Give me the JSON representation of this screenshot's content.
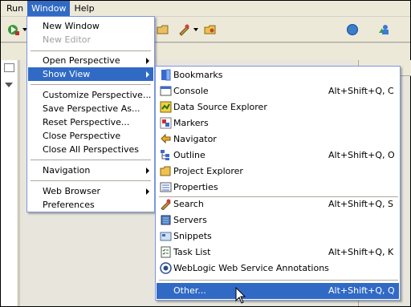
{
  "menubar": {
    "items": [
      {
        "label": "Run"
      },
      {
        "label": "Window"
      },
      {
        "label": "Help"
      }
    ]
  },
  "window_menu": {
    "items": [
      {
        "label": "New Window",
        "enabled": true
      },
      {
        "label": "New Editor",
        "enabled": false
      },
      {
        "label": "Open Perspective",
        "submenu": true
      },
      {
        "label": "Show View",
        "submenu": true,
        "active": true
      },
      {
        "label": "Customize Perspective..."
      },
      {
        "label": "Save Perspective As..."
      },
      {
        "label": "Reset Perspective..."
      },
      {
        "label": "Close Perspective"
      },
      {
        "label": "Close All Perspectives"
      },
      {
        "label": "Navigation",
        "submenu": true
      },
      {
        "label": "Web Browser",
        "submenu": true
      },
      {
        "label": "Preferences"
      }
    ]
  },
  "show_view_menu": {
    "items": [
      {
        "label": "Bookmarks",
        "shortcut": "",
        "icon": "bookmarks-icon"
      },
      {
        "label": "Console",
        "shortcut": "Alt+Shift+Q, C",
        "icon": "console-icon"
      },
      {
        "label": "Data Source Explorer",
        "shortcut": "",
        "icon": "data-source-icon"
      },
      {
        "label": "Markers",
        "shortcut": "",
        "icon": "markers-icon"
      },
      {
        "label": "Navigator",
        "shortcut": "",
        "icon": "navigator-icon"
      },
      {
        "label": "Outline",
        "shortcut": "Alt+Shift+Q, O",
        "icon": "outline-icon"
      },
      {
        "label": "Project Explorer",
        "shortcut": "",
        "icon": "project-explorer-icon"
      },
      {
        "label": "Properties",
        "shortcut": "",
        "icon": "properties-icon"
      },
      {
        "label": "Search",
        "shortcut": "Alt+Shift+Q, S",
        "icon": "search-icon"
      },
      {
        "label": "Servers",
        "shortcut": "",
        "icon": "servers-icon"
      },
      {
        "label": "Snippets",
        "shortcut": "",
        "icon": "snippets-icon"
      },
      {
        "label": "Task List",
        "shortcut": "Alt+Shift+Q, K",
        "icon": "task-list-icon"
      },
      {
        "label": "WebLogic Web Service Annotations",
        "shortcut": "",
        "icon": "weblogic-icon"
      },
      {
        "label": "Other...",
        "shortcut": "Alt+Shift+Q, Q",
        "icon": "",
        "active": true
      }
    ]
  },
  "colors": {
    "highlight": "#316ac5",
    "menu_bg": "#ffffff",
    "chrome": "#ece9d8"
  }
}
